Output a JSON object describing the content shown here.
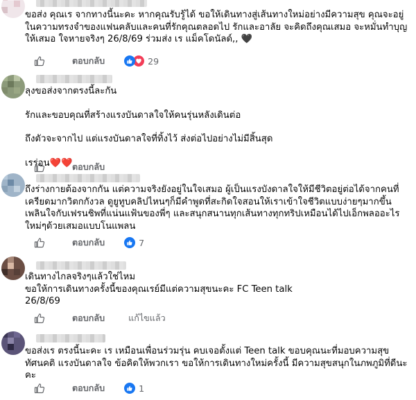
{
  "comments": [
    {
      "lines": [
        "ขอส่ง คุณเร จากทางนี้นะคะ หากคุณรับรู้ได้ ขอให้เดินทางสู่เส้นทางใหม่อย่างมีความสุข คุณจะอยู่",
        "ในความทรงจำของแฟนคลับและคนที่รักคุณตลอดไป รักและอาลัย จะคิดถึงคุณเสมอ จะหมั่นทำบุญ",
        "ให้เสมอ ใจหายจริงๆ 26/8/69 ร่วมส่ง เร แม็คโดนัลด์,, 🖤"
      ],
      "reply_label": "ตอบกลับ",
      "reaction_count": "29",
      "reaction_type": "like-love"
    },
    {
      "lines": [
        "ลุงขอส่งจากตรงนี้ละกัน",
        "",
        "รักและขอบคุณที่สร้างแรงบันดาลใจให้คนรุ่นหลังเดินต่อ",
        "",
        "ถึงตัวจะจากไป แต่แรงบันดาลใจที่ทิ้งไว้ ส่งต่อไปอย่างไม่มีสิ้นสุด",
        "",
        "เรร่อน❤️❤️"
      ],
      "reply_label": "ตอบกลับ",
      "reaction_count": "",
      "reaction_type": ""
    },
    {
      "lines": [
        "ถึงร่างกายต้องจากกัน แต่ความจริงยังอยู่ในใจเสมอ ผู้เป็นแรงบังดาลใจให้มีชีวิตอยู่ต่อได้จากคนที่",
        "เครียดมากวิตกกังวล ดูยูทูบคลิปไหนๆก็มีคำพูดที่สะกิดใจสอนให้เราเข้าใจชีวิตแบบง่ายๆมากขึ้น",
        "เพลินใจกับเฟรนชิพที่แน่นแฟ้นของพี่ๆ และสนุกสนานทุกเส้นทางทุกทริปเหมือนได้ไปเอ็กพลออะไร",
        "ใหม่ๆด้วยเสมอแบบโนแพลน"
      ],
      "reply_label": "ตอบกลับ",
      "reaction_count": "7",
      "reaction_type": "like"
    },
    {
      "lines": [
        "เดินทางไกลจริงๆแล้วใช่ไหม",
        "ขอให้การเดินทางครั้งนี้ของคุณเรย์มีแต่ความสุขนะคะ FC Teen talk",
        "26/8/69"
      ],
      "reply_label": "ตอบกลับ",
      "edited_label": "แก้ไขแล้ว",
      "reaction_count": "",
      "reaction_type": ""
    },
    {
      "lines": [
        "ขอส่งเร ตรงนี้นะคะ เร เหมือนเพื่อนร่วมรุ่น คบเจอตั้งแต่ Teen talk ขอบคุณนะที่มอบความสุข",
        "ทัศนคติ แรงบันดาลใจ ข้อคิดให้พวกเรา ขอให้การเดินทางใหม่ครั้งนี้ มีความสุขสนุกในภพภูมิที่ดีนะ",
        "คะ"
      ],
      "reply_label": "ตอบกลับ",
      "reaction_count": "1",
      "reaction_type": "like"
    }
  ],
  "colors": {
    "like_blue": "#1877f2",
    "love_red": "#f33e58",
    "secondary_text": "#65676b"
  },
  "icons": [
    "like-thumb-icon",
    "reply-arrow-icon",
    "like-reaction-icon",
    "love-reaction-icon"
  ]
}
